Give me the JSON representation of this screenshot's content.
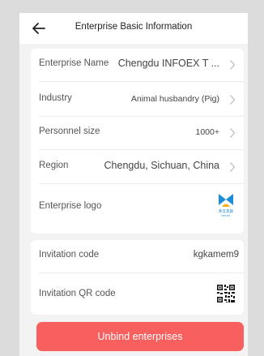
{
  "header": {
    "title": "Enterprise Basic Information"
  },
  "info": {
    "rows": [
      {
        "label": "Enterprise Name",
        "value": "Chengdu INFOEX T ...",
        "icon": "chevron-right-icon"
      },
      {
        "label": "Industry",
        "value": "Animal husbandry (Pig)",
        "icon": "chevron-right-icon"
      },
      {
        "label": "Personnel size",
        "value": "1000+",
        "icon": "chevron-right-icon"
      },
      {
        "label": "Region",
        "value": "Chengdu, Sichuan, China",
        "icon": "chevron-right-icon"
      },
      {
        "label": "Enterprise logo",
        "logo_text": "英孚克斯",
        "logo_subtext": "INFOEX"
      }
    ]
  },
  "invite": {
    "code_label": "Invitation code",
    "code_value": "kgkamem9",
    "qr_label": "Invitation QR code",
    "qr_icon": "qr-code-icon"
  },
  "actions": {
    "unbind_label": "Unbind enterprises"
  },
  "colors": {
    "accent": "#f7605f",
    "logo_blue": "#1f8dd6",
    "logo_gold": "#f2b01e"
  }
}
